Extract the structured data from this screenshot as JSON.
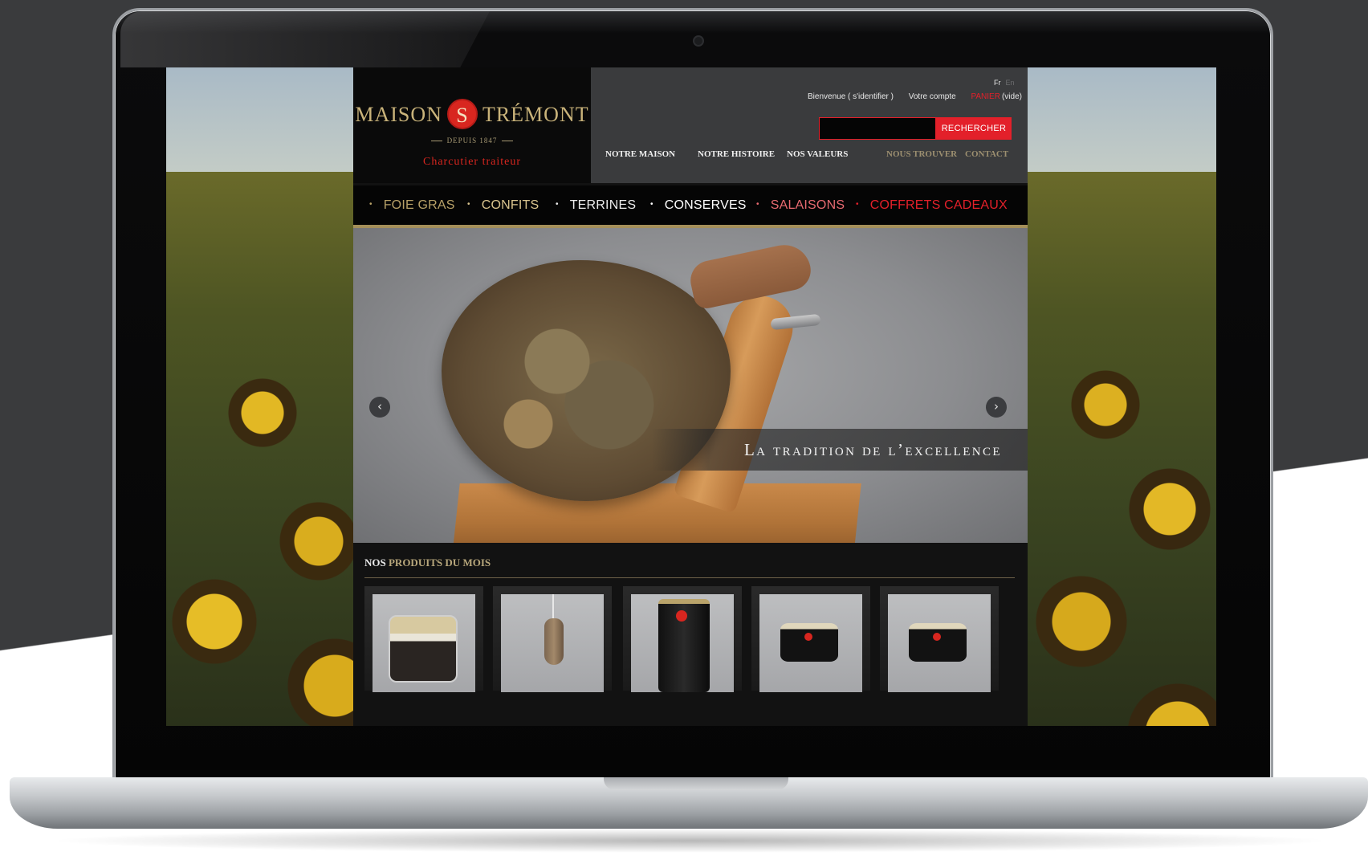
{
  "brand": {
    "name_part1": "MAISON",
    "seal_letter": "S",
    "name_part2": "TRÉMONT",
    "since": "DEPUIS 1847",
    "tagline": "Charcutier traiteur"
  },
  "language": {
    "current": "Fr",
    "other": "En"
  },
  "top_links": {
    "welcome": "Bienvenue ( s'identifier )",
    "account": "Votre compte",
    "cart": "PANIER",
    "cart_state": "(vide)"
  },
  "search": {
    "value": "",
    "button": "RECHERCHER"
  },
  "main_nav": [
    "NOTRE MAISON",
    "NOTRE HISTOIRE",
    "NOS VALEURS",
    "NOUS TROUVER",
    "CONTACT"
  ],
  "categories": [
    {
      "label": "FOIE GRAS",
      "color": "#b7a067"
    },
    {
      "label": "CONFITS",
      "color": "#d9c48e"
    },
    {
      "label": "TERRINES",
      "color": "#ececec"
    },
    {
      "label": "CONSERVES",
      "color": "#ffffff"
    },
    {
      "label": "SALAISONS",
      "color": "#e76a70"
    },
    {
      "label": "COFFRETS CADEAUX",
      "color": "#e3202a"
    }
  ],
  "slider": {
    "caption": "La tradition de l’excellence",
    "prev_icon": "chevron-left-icon",
    "next_icon": "chevron-right-icon"
  },
  "products_section": {
    "title_lead": "NOS",
    "title_rest": "PRODUITS DU MOIS",
    "items": [
      {
        "icon": "jar-icon"
      },
      {
        "icon": "sausage-icon"
      },
      {
        "icon": "tall-can-icon"
      },
      {
        "icon": "flat-can-icon"
      },
      {
        "icon": "flat-can-icon"
      }
    ]
  },
  "colors": {
    "accent_red": "#e3202a",
    "gold": "#b7a067",
    "header_grey": "#3a3b3d"
  }
}
